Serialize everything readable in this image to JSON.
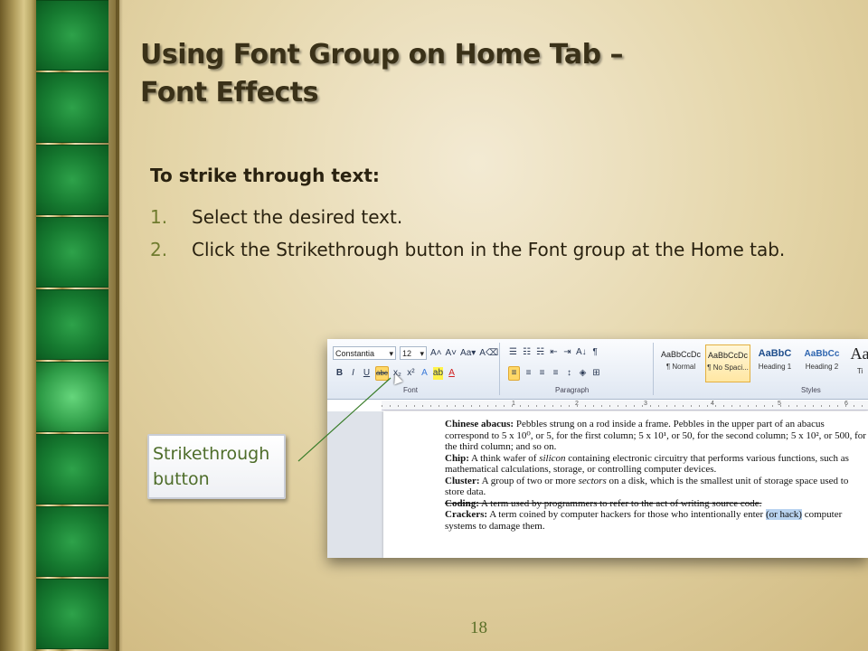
{
  "slide": {
    "title_line1": "Using Font Group on Home Tab –",
    "title_line2": "Font Effects",
    "subheading": "To strike through text:",
    "steps": [
      {
        "num": "1.",
        "text": "Select the desired text."
      },
      {
        "num": "2.",
        "text": "Click the Strikethrough button in the Font group at the Home tab."
      }
    ],
    "callout_line1": "Strikethrough",
    "callout_line2": "button",
    "page_number": "18"
  },
  "ribbon": {
    "font_name": "Constantia",
    "font_size": "12",
    "group_font": "Font",
    "group_paragraph": "Paragraph",
    "group_styles": "Styles",
    "buttons": {
      "grow": "A˄",
      "shrink": "A˅",
      "case": "Aa▾",
      "clear": "A⌫",
      "bold": "B",
      "italic": "I",
      "underline": "U",
      "strike": "abc",
      "subscript": "x₂",
      "superscript": "x²",
      "effects": "A",
      "highlight": "ab",
      "color": "A",
      "bullets": "☰",
      "numbering": "☷",
      "multilevel": "☵",
      "decrease": "⇤",
      "increase": "⇥",
      "sort": "A↓",
      "show": "¶",
      "left": "≡",
      "center": "≡",
      "right": "≡",
      "justify": "≡",
      "spacing": "↕",
      "shading": "◈",
      "borders": "⊞"
    },
    "styles": [
      {
        "sample": "AaBbCcDc",
        "label": "¶ Normal"
      },
      {
        "sample": "AaBbCcDc",
        "label": "¶ No Spaci..."
      },
      {
        "sample": "AaBbC",
        "label": "Heading 1"
      },
      {
        "sample": "AaBbCc",
        "label": "Heading 2"
      },
      {
        "sample": "Aa",
        "label": "Ti"
      }
    ],
    "ruler_numbers": [
      "1",
      "2",
      "3",
      "4",
      "5",
      "6"
    ]
  },
  "document": {
    "p1_term": "Chinese abacus:",
    "p1_text": " Pebbles strung on a rod inside a frame. Pebbles in the upper part of an abacus correspond to 5 x 10⁰, or 5, for the first column; 5 x 10¹, or 50, for the second column; 5 x 10², or 500, for the third column; and so on.",
    "p2_term": "Chip:",
    "p2_text_a": " A think wafer of ",
    "p2_italic": "silicon",
    "p2_text_b": "  containing electronic circuitry that performs various functions, such as mathematical calculations, storage, or controlling computer devices.",
    "p3_term": "Cluster:",
    "p3_text_a": " A group of two or more ",
    "p3_italic": "sectors",
    "p3_text_b": "  on a disk, which is the smallest unit of storage space used to store data.",
    "p4_term": "Coding:",
    "p4_text": " A term used by programmers to refer to the act of writing source code.",
    "p5_term": "Crackers:",
    "p5_text": " A term coined by computer hackers for those who intentionally enter ",
    "p5_highlight": "(or hack)",
    "p5_text_end": " computer systems to damage them."
  }
}
